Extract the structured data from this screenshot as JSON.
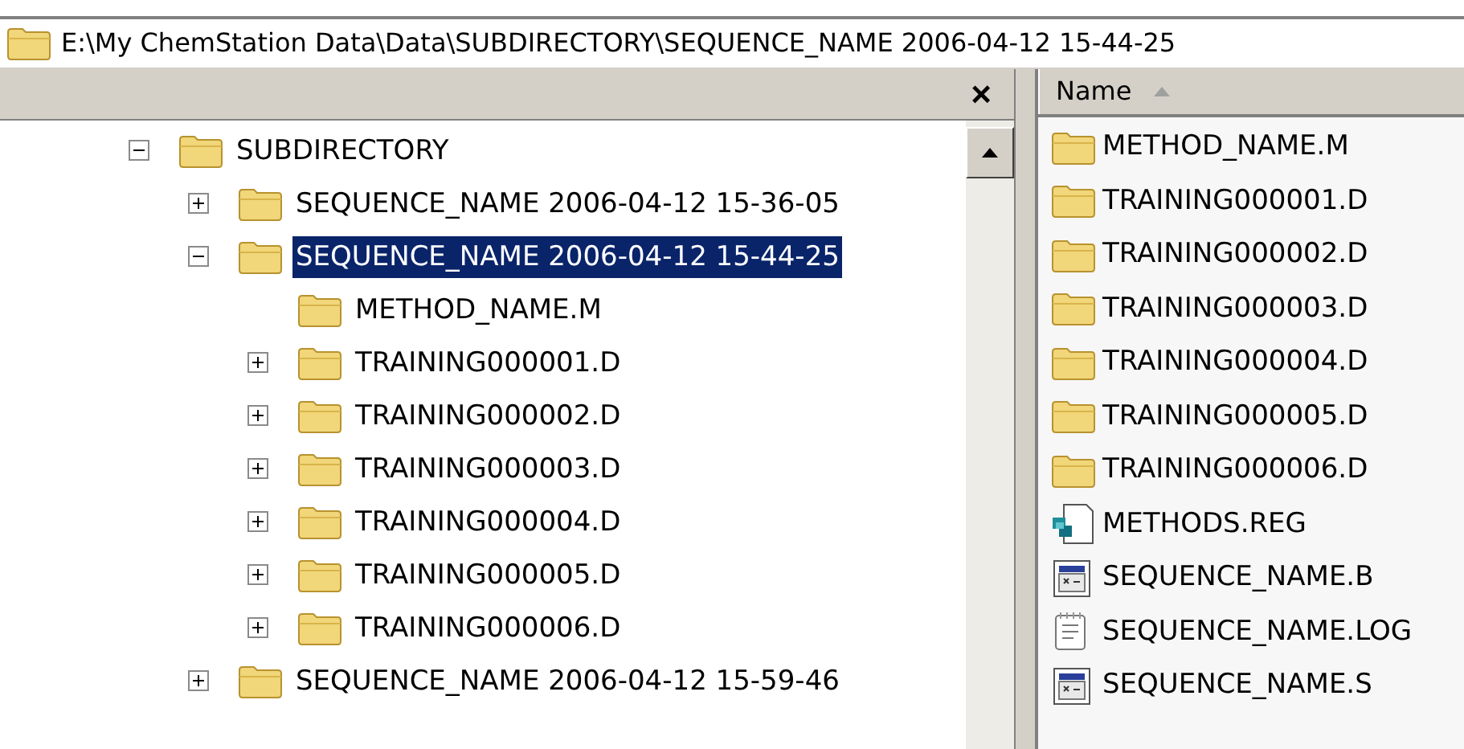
{
  "address_bar": {
    "path": "E:\\My ChemStation Data\\Data\\SUBDIRECTORY\\SEQUENCE_NAME 2006-04-12 15-44-25"
  },
  "folder_pane": {
    "close": "×",
    "tree": [
      {
        "label": "SUBDIRECTORY",
        "expanded": true,
        "selected": false,
        "children": [
          {
            "label": "SEQUENCE_NAME 2006-04-12 15-36-05",
            "expanded": false,
            "selected": false
          },
          {
            "label": "SEQUENCE_NAME 2006-04-12 15-44-25",
            "expanded": true,
            "selected": true,
            "children": [
              {
                "label": "METHOD_NAME.M",
                "selected": false
              },
              {
                "label": "TRAINING000001.D",
                "expanded": false,
                "selected": false
              },
              {
                "label": "TRAINING000002.D",
                "expanded": false,
                "selected": false
              },
              {
                "label": "TRAINING000003.D",
                "expanded": false,
                "selected": false
              },
              {
                "label": "TRAINING000004.D",
                "expanded": false,
                "selected": false
              },
              {
                "label": "TRAINING000005.D",
                "expanded": false,
                "selected": false
              },
              {
                "label": "TRAINING000006.D",
                "expanded": false,
                "selected": false
              }
            ]
          },
          {
            "label": "SEQUENCE_NAME 2006-04-12 15-59-46",
            "expanded": false,
            "selected": false
          }
        ]
      }
    ]
  },
  "file_list": {
    "columns": [
      {
        "label": "Name",
        "sorted_ascending": true
      }
    ],
    "items": [
      {
        "name": "METHOD_NAME.M",
        "kind": "folder"
      },
      {
        "name": "TRAINING000001.D",
        "kind": "folder"
      },
      {
        "name": "TRAINING000002.D",
        "kind": "folder"
      },
      {
        "name": "TRAINING000003.D",
        "kind": "folder"
      },
      {
        "name": "TRAINING000004.D",
        "kind": "folder"
      },
      {
        "name": "TRAINING000005.D",
        "kind": "folder"
      },
      {
        "name": "TRAINING000006.D",
        "kind": "folder"
      },
      {
        "name": "METHODS.REG",
        "kind": "registry"
      },
      {
        "name": "SEQUENCE_NAME.B",
        "kind": "app"
      },
      {
        "name": "SEQUENCE_NAME.LOG",
        "kind": "text"
      },
      {
        "name": "SEQUENCE_NAME.S",
        "kind": "app"
      }
    ]
  }
}
